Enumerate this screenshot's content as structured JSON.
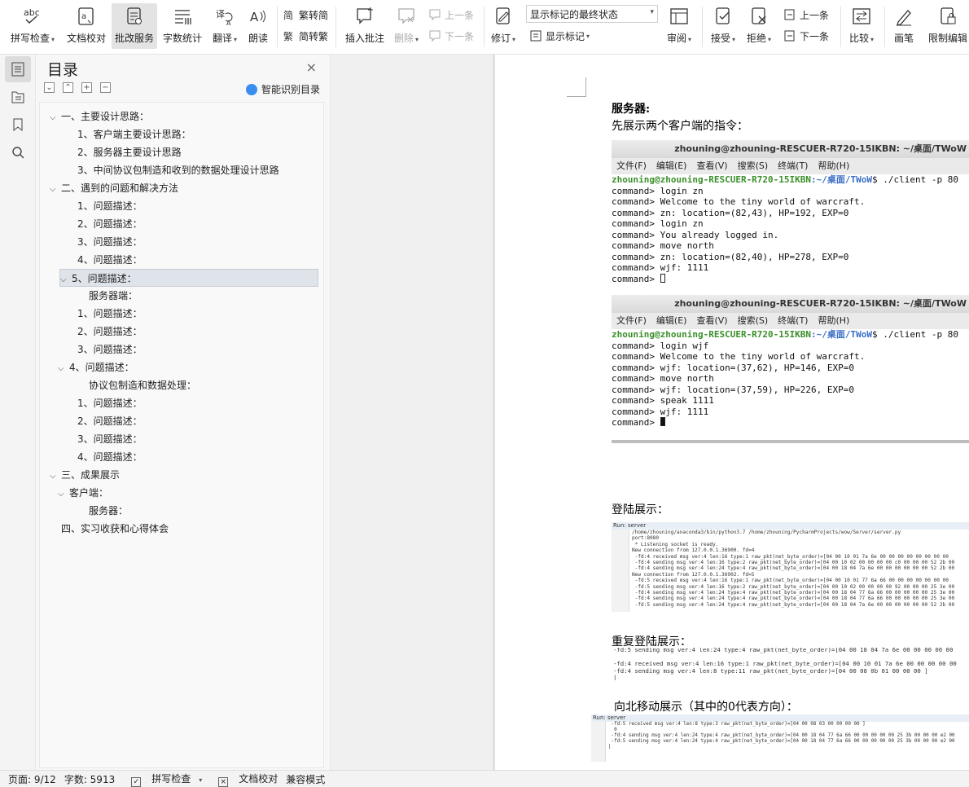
{
  "ribbon": {
    "spell_check": "拼写检查",
    "doc_proof": "文档校对",
    "review_service": "批改服务",
    "word_count": "字数统计",
    "translate": "翻译",
    "read_aloud": "朗读",
    "trad_to_simp": "繁转简",
    "simp_to_trad": "简转繁",
    "insert_comment": "插入批注",
    "delete": "删除",
    "prev_comment": "上一条",
    "next_comment": "下一条",
    "track_changes": "修订",
    "markup_state": "显示标记的最终状态",
    "show_markup": "显示标记",
    "review": "审阅",
    "accept": "接受",
    "reject": "拒绝",
    "prev_change": "上一条",
    "next_change": "下一条",
    "compare": "比较",
    "pen": "画笔",
    "restrict_edit": "限制编辑"
  },
  "toc": {
    "title": "目录",
    "close": "×",
    "smart_recognize": "智能识别目录",
    "items": [
      {
        "text": "一、主要设计思路：",
        "chev": "v"
      },
      {
        "text": "1、客户端主要设计思路：",
        "chev": ""
      },
      {
        "text": "2、服务器主要设计思路",
        "chev": ""
      },
      {
        "text": "3、中间协议包制造和收到的数据处理设计思路",
        "chev": ""
      },
      {
        "text": "二、遇到的问题和解决方法",
        "chev": "v"
      },
      {
        "text": "1、问题描述：",
        "chev": ""
      },
      {
        "text": "2、问题描述：",
        "chev": ""
      },
      {
        "text": "3、问题描述：",
        "chev": ""
      },
      {
        "text": "4、问题描述：",
        "chev": ""
      },
      {
        "text": "5、问题描述：",
        "chev": "v"
      },
      {
        "text": "服务器端：",
        "chev": ""
      },
      {
        "text": "1、问题描述：",
        "chev": ""
      },
      {
        "text": "2、问题描述：",
        "chev": ""
      },
      {
        "text": "3、问题描述：",
        "chev": ""
      },
      {
        "text": "4、问题描述：",
        "chev": "v"
      },
      {
        "text": "协议包制造和数据处理：",
        "chev": ""
      },
      {
        "text": "1、问题描述：",
        "chev": ""
      },
      {
        "text": "2、问题描述：",
        "chev": ""
      },
      {
        "text": "3、问题描述：",
        "chev": ""
      },
      {
        "text": "4、问题描述：",
        "chev": ""
      },
      {
        "text": "三、成果展示",
        "chev": "v"
      },
      {
        "text": "客户端：",
        "chev": "v"
      },
      {
        "text": "服务器：",
        "chev": ""
      },
      {
        "text": "四、实习收获和心得体会",
        "chev": ""
      }
    ]
  },
  "doc": {
    "heading": "服务器:",
    "intro": "先展示两个客户端的指令：",
    "term1": {
      "title": "zhouning@zhouning-RESCUER-R720-15IKBN: ~/桌面/TWoW",
      "menu": [
        "文件(F)",
        "编辑(E)",
        "查看(V)",
        "搜索(S)",
        "终端(T)",
        "帮助(H)"
      ],
      "prompt_user": "zhouning@zhouning-RESCUER-R720-15IKBN",
      "prompt_path": ":~/桌面/TWoW",
      "prompt_cmd": "$ ./client -p 80",
      "lines": "command> login zn\ncommand> Welcome to the tiny world of warcraft.\ncommand> zn: location=(82,43), HP=192, EXP=0\ncommand> login zn\ncommand> You already logged in.\ncommand> move north\ncommand> zn: location=(82,40), HP=278, EXP=0\ncommand> wjf: 1111\ncommand> "
    },
    "term2": {
      "title": "zhouning@zhouning-RESCUER-R720-15IKBN: ~/桌面/TWoW",
      "menu": [
        "文件(F)",
        "编辑(E)",
        "查看(V)",
        "搜索(S)",
        "终端(T)",
        "帮助(H)"
      ],
      "prompt_user": "zhouning@zhouning-RESCUER-R720-15IKBN",
      "prompt_path": ":~/桌面/TWoW",
      "prompt_cmd": "$ ./client -p 80",
      "lines": "command> login wjf\ncommand> Welcome to the tiny world of warcraft.\ncommand> wjf: location=(37,62), HP=146, EXP=0\ncommand> move north\ncommand> wjf: location=(37,59), HP=226, EXP=0\ncommand> speak 1111\ncommand> wjf: 1111\ncommand> "
    },
    "login_label": "登陆展示：",
    "login_shot": {
      "run_tab": "Run: server",
      "lines": "/home/zhouning/anaconda3/bin/python3.7 /home/zhouning/PycharmProjects/wow/Server/server.py\nport:8080\n * Listening socket is ready.\nNew connection from 127.0.0.1.36900. fd=4\n -fd:4 received msg ver:4 len:16 type:1 raw_pkt(net_byte_order)=[04 00 10 01 7a 6e 00 00 00 00 00 00 00 00\n -fd:4 sending msg ver:4 len:16 type:2 raw_pkt(net_byte_order)=[04 00 10 02 00 00 00 00 c0 00 00 00 52 2b 00\n -fd:4 sending msg ver:4 len:24 type:4 raw_pkt(net_byte_order)=[04 00 18 04 7a 6e 00 00 00 00 00 00 52 2b 00\nNew connection from 127.0.0.1.36902. fd=5\n -fd:5 received msg ver:4 len:16 type:1 raw_pkt(net_byte_order)=[04 00 10 01 77 6a 66 00 00 00 00 00 00 00\n -fd:5 sending msg ver:4 len:16 type:2 raw_pkt(net_byte_order)=[04 00 10 02 00 00 00 00 92 00 00 00 25 3e 00\n -fd:4 sending msg ver:4 len:24 type:4 raw_pkt(net_byte_order)=[04 00 18 04 77 6a 66 00 00 00 00 00 25 3e 00\n -fd:4 sending msg ver:4 len:24 type:4 raw_pkt(net_byte_order)=[04 00 18 04 77 6a 66 00 00 00 00 00 25 3e 00\n -fd:5 sending msg ver:4 len:24 type:4 raw_pkt(net_byte_order)=[04 00 18 04 7a 6e 00 00 00 00 00 00 52 2b 00"
    },
    "relogin_label": "重复登陆展示：",
    "relogin_shot": {
      "lines": "-fd:5 sending msg ver:4 len:24 type:4 raw_pkt(net_byte_order)=[04 00 18 04 7a 6e 00 00 00 00 00\n\n-fd:4 received msg ver:4 len:16 type:1 raw_pkt(net_byte_order)=[04 00 10 01 7a 6e 00 00 00 00 00\n-fd:4 sending msg ver:4 len:8 type:11 raw_pkt(net_byte_order)=[04 00 08 0b 01 00 00 00 ]\n|"
    },
    "move_label": "向北移动展示（其中的0代表方向）：",
    "move_shot": {
      "run_tab": "Run: server",
      "lines": " -fd:5 received msg ver:4 len:8 type:3 raw_pkt(net_byte_order)=[04 00 08 03 00 00 00 00 ]\n  0\n -fd:4 sending msg ver:4 len:24 type:4 raw_pkt(net_byte_order)=[04 00 18 04 77 6a 66 00 00 00 00 00 25 3b 00 00 00 e2 00\n -fd:5 sending msg ver:4 len:24 type:4 raw_pkt(net_byte_order)=[04 00 18 04 77 6a 66 00 00 00 00 00 25 3b 00 00 00 e2 00\n|"
    }
  },
  "status": {
    "page": "页面: 9/12",
    "words": "字数: 5913",
    "spell": "拼写检查",
    "proof": "文档校对",
    "compat": "兼容模式"
  }
}
